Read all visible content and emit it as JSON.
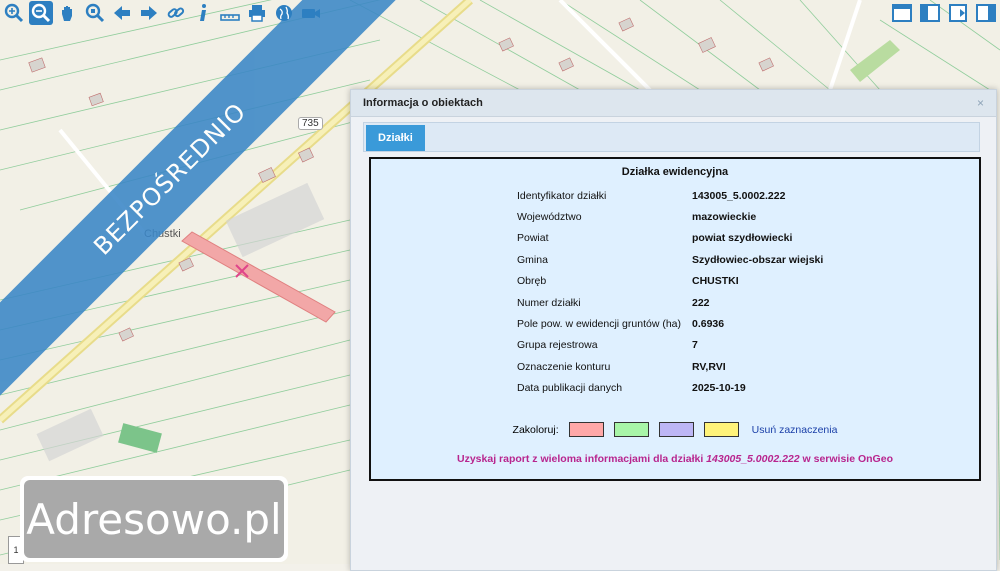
{
  "toolbar": {
    "tools": [
      {
        "icon": "zoom-in-icon"
      },
      {
        "icon": "zoom-out-icon"
      },
      {
        "icon": "pan-hand-icon"
      },
      {
        "icon": "zoom-extent-icon"
      },
      {
        "icon": "arrow-left-icon"
      },
      {
        "icon": "arrow-right-icon"
      },
      {
        "icon": "link-icon"
      },
      {
        "icon": "info-icon"
      },
      {
        "icon": "measure-icon"
      },
      {
        "icon": "print-icon"
      },
      {
        "icon": "globe-icon"
      },
      {
        "icon": "camera-icon"
      }
    ],
    "right_tools": [
      {
        "icon": "layout-full-icon"
      },
      {
        "icon": "layout-split-icon"
      },
      {
        "icon": "export-icon"
      },
      {
        "icon": "panel-toggle-icon"
      }
    ],
    "accent": "#2d7fc1"
  },
  "map": {
    "place_label": "Chustki",
    "road_number": "735",
    "banner_text": "BEZPOŚREDNIO",
    "banner_color": "#3a86c6",
    "parcel_color": "#f2a7a7"
  },
  "watermark": {
    "text": "Adresowo.pl"
  },
  "panel": {
    "title": "Informacja o obiektach",
    "close": "×",
    "tab_label": "Działki",
    "section_title": "Działka ewidencyjna",
    "rows": [
      {
        "label": "Identyfikator działki",
        "value": "143005_5.0002.222"
      },
      {
        "label": "Województwo",
        "value": "mazowieckie"
      },
      {
        "label": "Powiat",
        "value": "powiat szydłowiecki"
      },
      {
        "label": "Gmina",
        "value": "Szydłowiec-obszar wiejski"
      },
      {
        "label": "Obręb",
        "value": "CHUSTKI"
      },
      {
        "label": "Numer działki",
        "value": "222"
      },
      {
        "label": "Pole pow. w ewidencji gruntów (ha)",
        "value": "0.6936"
      },
      {
        "label": "Grupa rejestrowa",
        "value": "7"
      },
      {
        "label": "Oznaczenie konturu",
        "value": "RV,RVI"
      },
      {
        "label": "Data publikacji danych",
        "value": "2025-10-19"
      }
    ],
    "color_label": "Zakoloruj:",
    "swatches": [
      "#ffa8a8",
      "#a8f5a8",
      "#bdb6f5",
      "#fff37a"
    ],
    "clear_label": "Usuń zaznaczenia",
    "report_prefix": "Uzyskaj raport z wieloma informacjami dla działki",
    "report_id": "143005_5.0002.222",
    "report_suffix": "w serwisie OnGeo"
  }
}
